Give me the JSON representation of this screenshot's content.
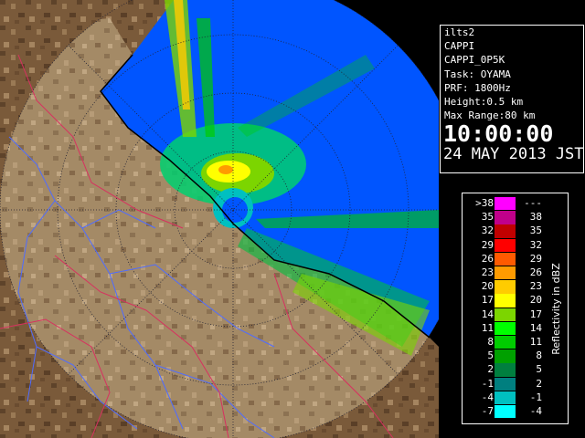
{
  "info": {
    "radar": "ilts2",
    "product": "CAPPI",
    "product_code": "CAPPI_0P5K",
    "task": "Task: OYAMA",
    "prf": "PRF: 1800Hz",
    "height": "Height:0.5 km",
    "max_range": "Max Range:80 km",
    "time": "10:00:00",
    "date": "24 MAY 2013 JST"
  },
  "legend": {
    "unit": "Reflectivity in dBZ",
    "rows": [
      {
        "lo": ">38",
        "hi": "---",
        "color": "#ff00ff"
      },
      {
        "lo": "35",
        "hi": "38",
        "color": "#c0008a"
      },
      {
        "lo": "32",
        "hi": "35",
        "color": "#c00000"
      },
      {
        "lo": "29",
        "hi": "32",
        "color": "#ff0000"
      },
      {
        "lo": "26",
        "hi": "29",
        "color": "#ff5a00"
      },
      {
        "lo": "23",
        "hi": "26",
        "color": "#ff9b00"
      },
      {
        "lo": "20",
        "hi": "23",
        "color": "#ffcc00"
      },
      {
        "lo": "17",
        "hi": "20",
        "color": "#ffff00"
      },
      {
        "lo": "14",
        "hi": "17",
        "color": "#7cd500"
      },
      {
        "lo": "11",
        "hi": "14",
        "color": "#00ff00"
      },
      {
        "lo": "8",
        "hi": "11",
        "color": "#00cc00"
      },
      {
        "lo": "5",
        "hi": "8",
        "color": "#00a000"
      },
      {
        "lo": "2",
        "hi": "5",
        "color": "#007f3f"
      },
      {
        "lo": "-1",
        "hi": "2",
        "color": "#007f7f"
      },
      {
        "lo": "-4",
        "hi": "-1",
        "color": "#00c0c0"
      },
      {
        "lo": "-7",
        "hi": "-4",
        "color": "#00ffff"
      }
    ]
  },
  "colors": {
    "echo_blue": "#0055ff",
    "terrain": "#7a5a3a",
    "rivers": "#4f6cff",
    "borders": "#d83060",
    "coast": "#000000"
  }
}
